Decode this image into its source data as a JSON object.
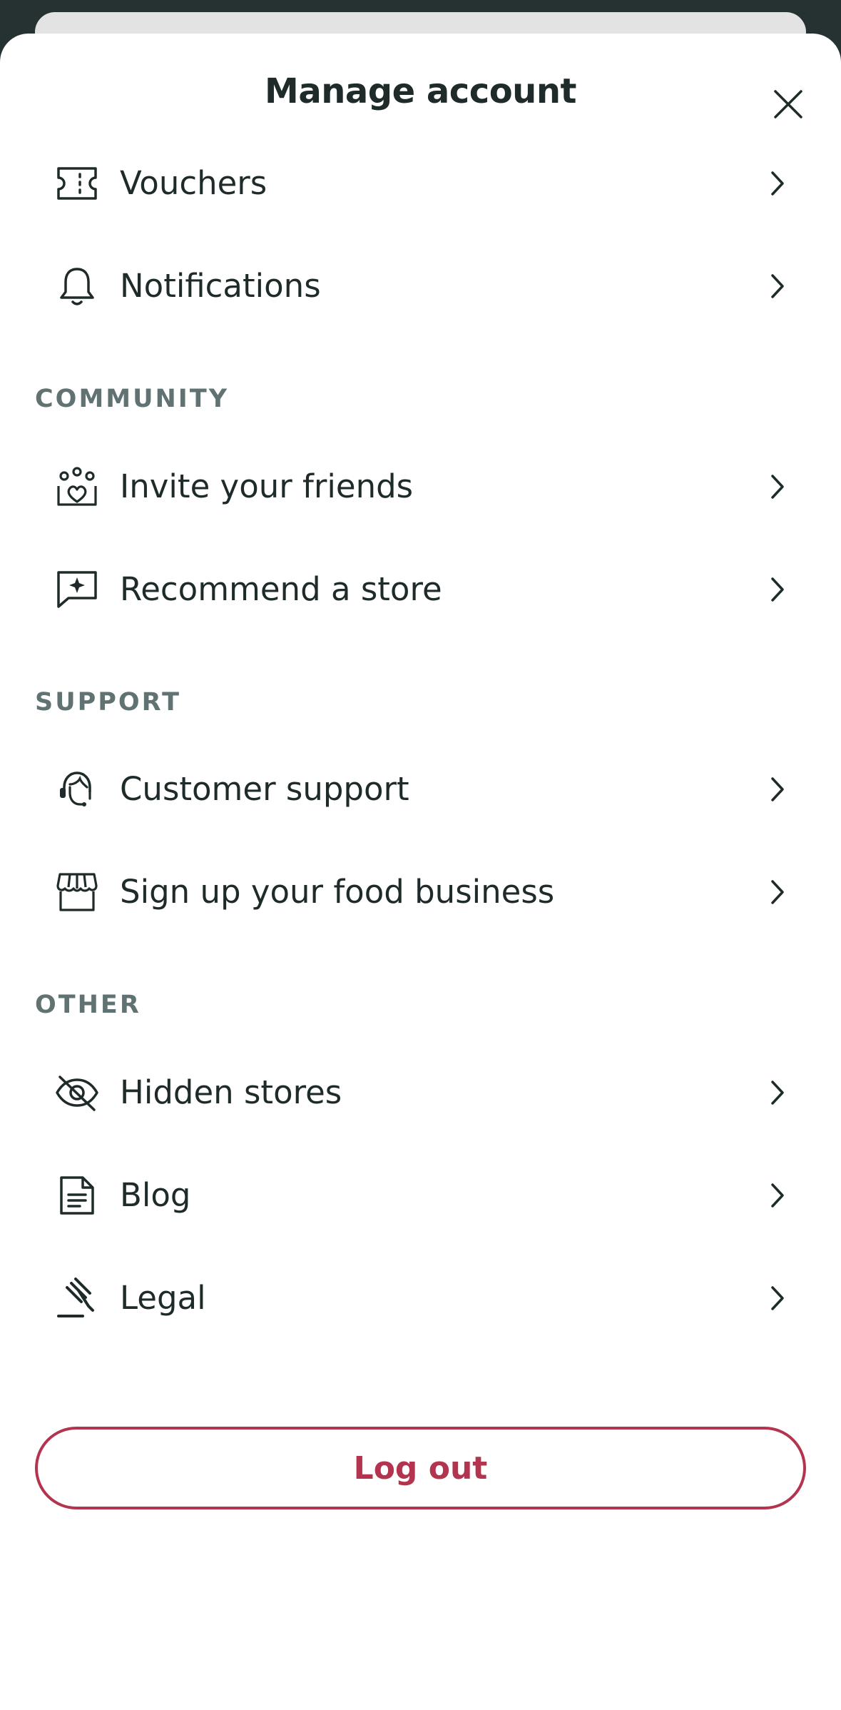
{
  "header": {
    "title": "Manage account"
  },
  "sections": {
    "community": "COMMUNITY",
    "support": "SUPPORT",
    "other": "OTHER"
  },
  "items": {
    "vouchers": "Vouchers",
    "notifications": "Notifications",
    "invite": "Invite your friends",
    "recommend": "Recommend a store",
    "customer_support": "Customer support",
    "signup_business": "Sign up your food business",
    "hidden_stores": "Hidden stores",
    "blog": "Blog",
    "legal": "Legal"
  },
  "logout_label": "Log out",
  "colors": {
    "accent": "#b3344f",
    "text": "#1e2b2a",
    "section": "#607272",
    "backdrop": "#263231"
  }
}
